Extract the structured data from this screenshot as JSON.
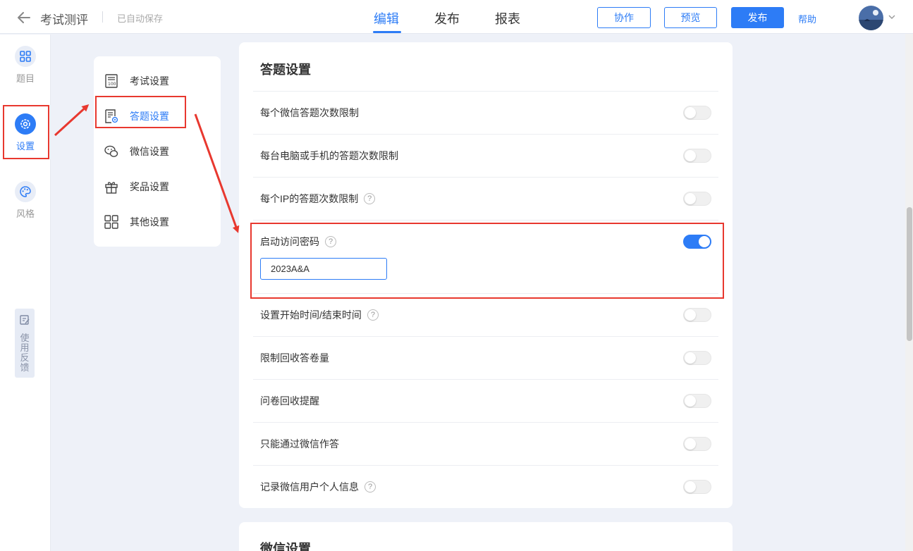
{
  "header": {
    "title": "考试测评",
    "autosave": "已自动保存",
    "tabs": [
      "编辑",
      "发布",
      "报表"
    ],
    "buttons": {
      "collab": "协作",
      "preview": "预览",
      "publish": "发布"
    },
    "help": "帮助"
  },
  "rail": {
    "items": [
      "题目",
      "设置",
      "风格"
    ],
    "feedback": "使用反馈"
  },
  "menu": {
    "items": [
      "考试设置",
      "答题设置",
      "微信设置",
      "奖品设置",
      "其他设置"
    ]
  },
  "answer_settings": {
    "title": "答题设置",
    "rows": [
      "每个微信答题次数限制",
      "每台电脑或手机的答题次数限制",
      "每个IP的答题次数限制",
      "启动访问密码",
      "设置开始时间/结束时间",
      "限制回收答卷量",
      "问卷回收提醒",
      "只能通过微信作答",
      "记录微信用户个人信息"
    ],
    "password_value": "2023A&A"
  },
  "wechat_settings": {
    "title": "微信设置"
  },
  "help_mark": "?",
  "colors": {
    "accent": "#2d7cf6",
    "annotation": "#e8382f"
  }
}
